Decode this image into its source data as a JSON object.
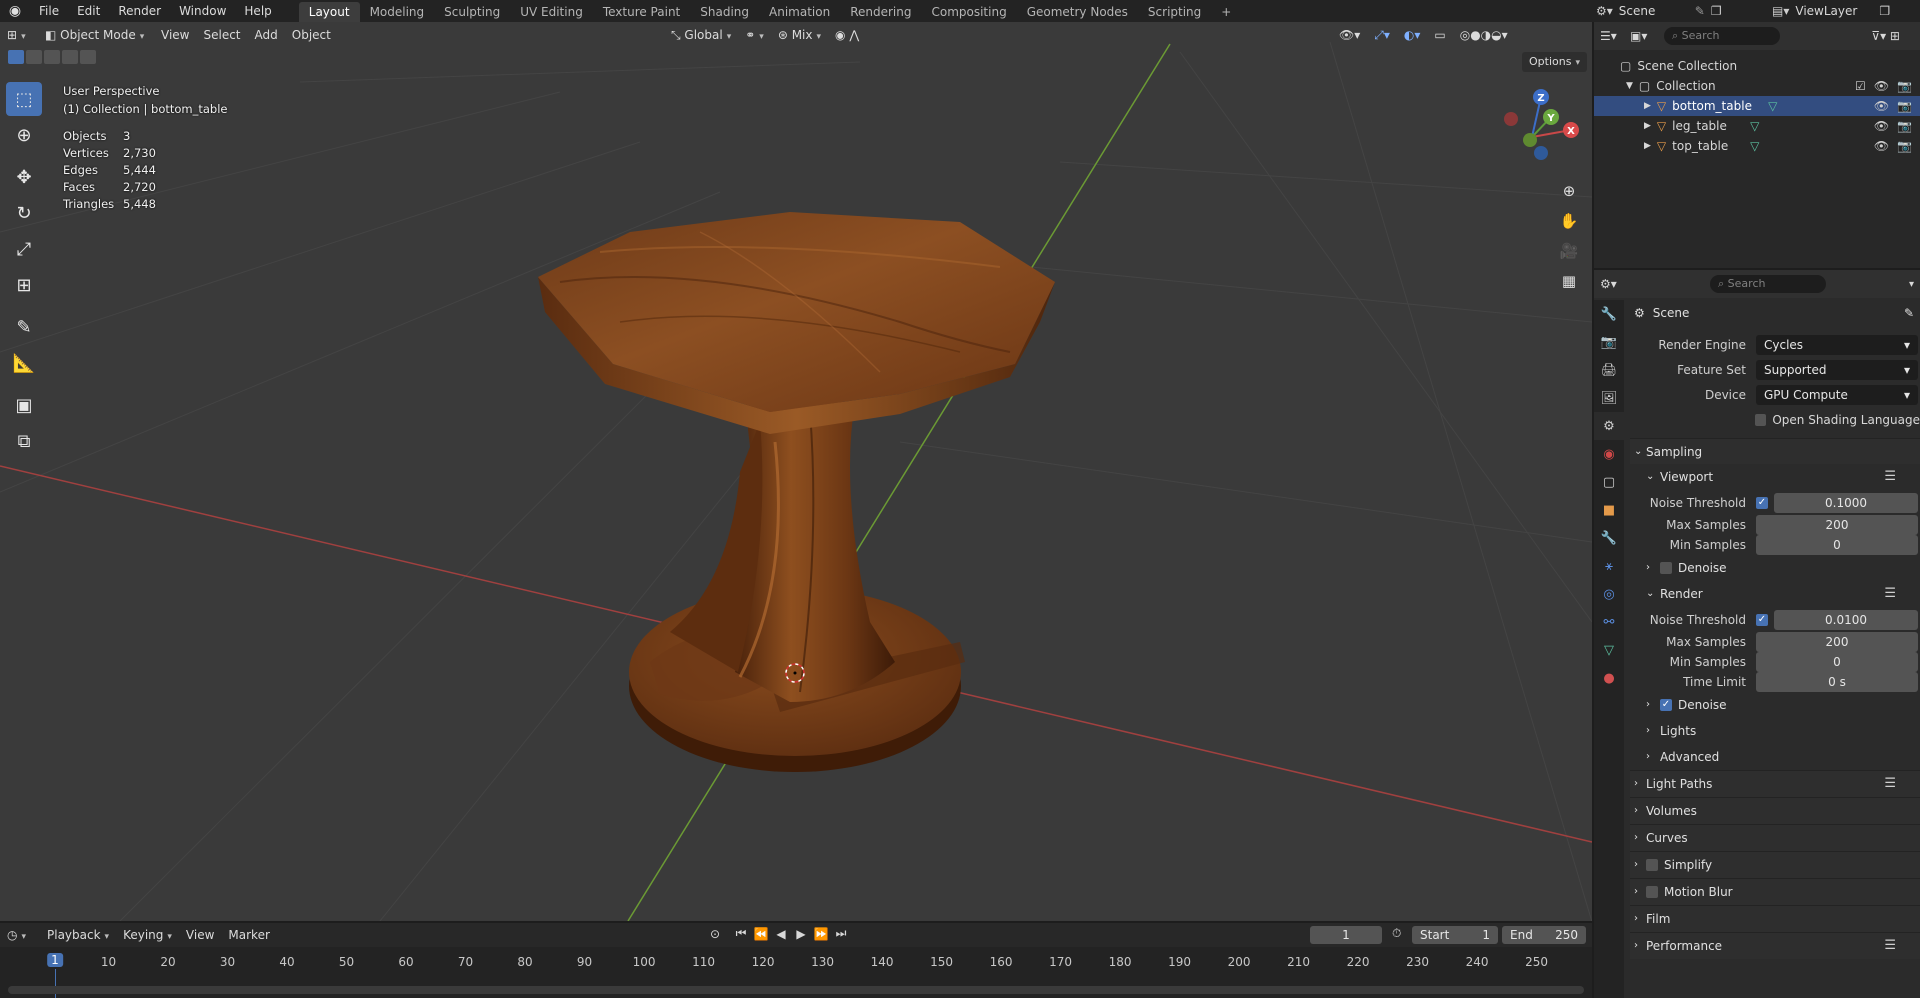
{
  "topbar": {
    "menus": [
      "File",
      "Edit",
      "Render",
      "Window",
      "Help"
    ],
    "workspaces": [
      "Layout",
      "Modeling",
      "Sculpting",
      "UV Editing",
      "Texture Paint",
      "Shading",
      "Animation",
      "Rendering",
      "Compositing",
      "Geometry Nodes",
      "Scripting"
    ],
    "active_workspace": "Layout",
    "add_workspace": "+",
    "scene_label": "Scene",
    "viewlayer_label": "ViewLayer"
  },
  "viewport": {
    "mode": "Object Mode",
    "menus": [
      "View",
      "Select",
      "Add",
      "Object"
    ],
    "transform_orientation": "Global",
    "snap_mode": "Mix",
    "options_label": "Options",
    "perspective": "User Perspective",
    "context": "(1) Collection | bottom_table",
    "stats": [
      {
        "key": "Objects",
        "value": "3"
      },
      {
        "key": "Vertices",
        "value": "2,730"
      },
      {
        "key": "Edges",
        "value": "5,444"
      },
      {
        "key": "Faces",
        "value": "2,720"
      },
      {
        "key": "Triangles",
        "value": "5,448"
      }
    ],
    "gizmo": {
      "x": "X",
      "y": "Y",
      "z": "Z"
    }
  },
  "outliner": {
    "search_placeholder": "Search",
    "scene_collection": "Scene Collection",
    "collection": "Collection",
    "objects": [
      {
        "name": "bottom_table",
        "selected": true
      },
      {
        "name": "leg_table",
        "selected": false
      },
      {
        "name": "top_table",
        "selected": false
      }
    ]
  },
  "properties": {
    "search_placeholder": "Search",
    "context_title": "Scene",
    "render_engine_label": "Render Engine",
    "render_engine": "Cycles",
    "feature_set_label": "Feature Set",
    "feature_set": "Supported",
    "device_label": "Device",
    "device": "GPU Compute",
    "osl_label": "Open Shading Language",
    "sampling": "Sampling",
    "viewport_sub": "Viewport",
    "vp_noise_threshold_label": "Noise Threshold",
    "vp_noise_threshold": "0.1000",
    "vp_max_samples_label": "Max Samples",
    "vp_max_samples": "200",
    "vp_min_samples_label": "Min Samples",
    "vp_min_samples": "0",
    "vp_denoise": "Denoise",
    "render_sub": "Render",
    "r_noise_threshold_label": "Noise Threshold",
    "r_noise_threshold": "0.0100",
    "r_max_samples_label": "Max Samples",
    "r_max_samples": "200",
    "r_min_samples_label": "Min Samples",
    "r_min_samples": "0",
    "r_time_limit_label": "Time Limit",
    "r_time_limit": "0 s",
    "r_denoise": "Denoise",
    "lights": "Lights",
    "advanced": "Advanced",
    "light_paths": "Light Paths",
    "volumes": "Volumes",
    "curves": "Curves",
    "simplify": "Simplify",
    "motion_blur": "Motion Blur",
    "film": "Film",
    "performance": "Performance"
  },
  "timeline": {
    "playback": "Playback",
    "keying": "Keying",
    "view": "View",
    "marker": "Marker",
    "current_frame": "1",
    "start_label": "Start",
    "start": "1",
    "end_label": "End",
    "end": "250",
    "ticks": [
      "10",
      "20",
      "30",
      "40",
      "50",
      "60",
      "70",
      "80",
      "90",
      "100",
      "110",
      "120",
      "130",
      "140",
      "150",
      "160",
      "170",
      "180",
      "190",
      "200",
      "210",
      "220",
      "230",
      "240",
      "250"
    ],
    "playhead": "1"
  },
  "colors": {
    "accent": "#4772b3",
    "selected_row": "#334d80",
    "x_axis": "#b84a4a",
    "y_axis": "#6f9a3a",
    "wood": "#8a4a1c"
  }
}
